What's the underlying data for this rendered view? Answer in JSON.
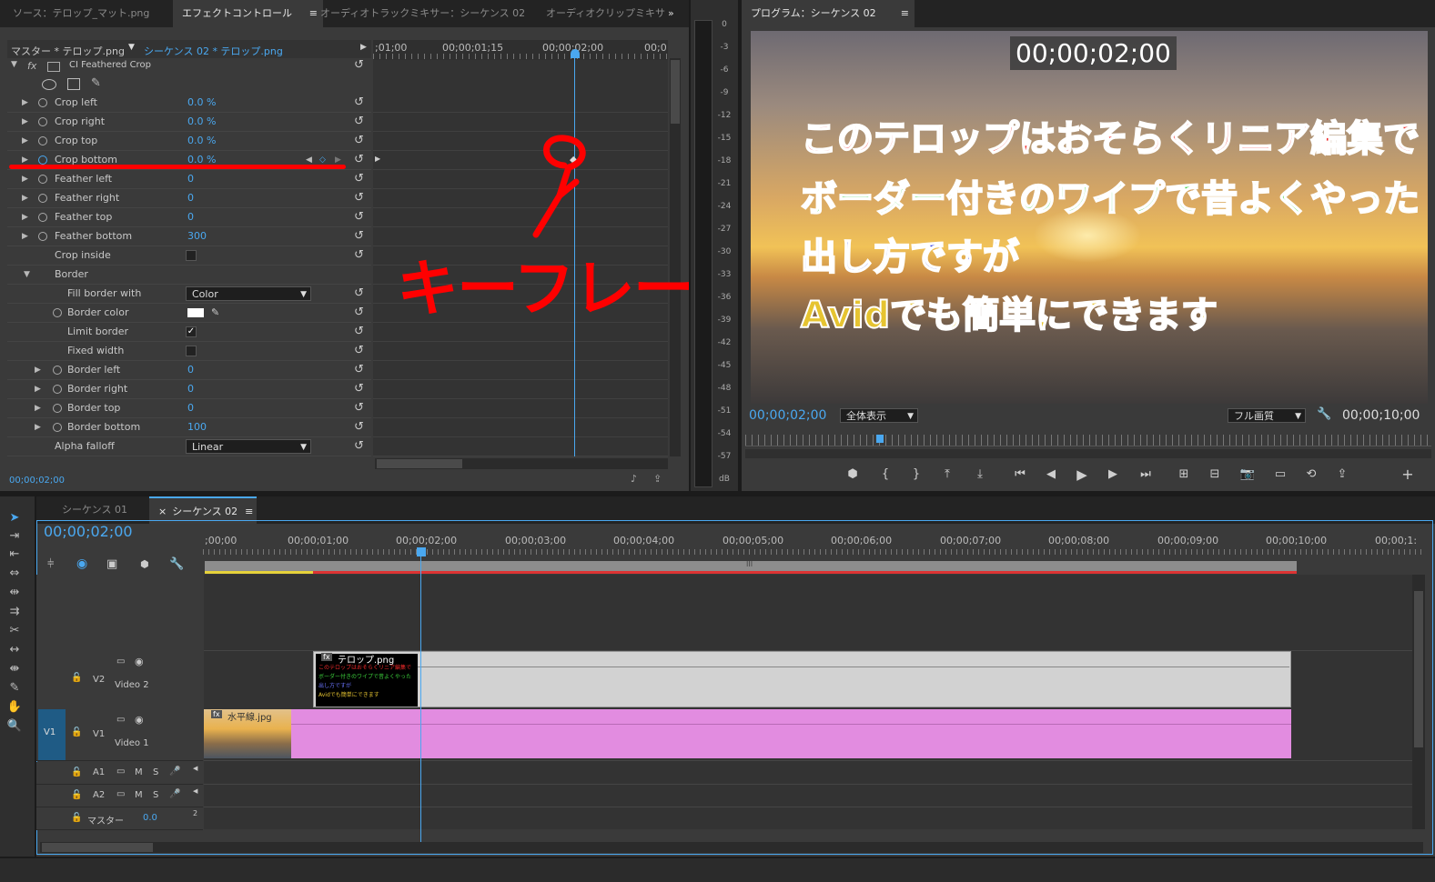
{
  "tabs_left": [
    "ソース：テロップ_マット.png",
    "エフェクトコントロール",
    "オーディオトラックミキサー：シーケンス 02",
    "オーディオクリップミキサ"
  ],
  "tabs_left_more": "»",
  "program_title": "プログラム：シーケンス 02",
  "panel_menu_icon": "≡",
  "effect_controls": {
    "master_label": "マスター * テロップ.png",
    "sequence_label": "シーケンス 02 * テロップ.png",
    "effect_name": "CI Feathered Crop",
    "fx_label": "fx",
    "ruler_times": [
      ";01;00",
      "00;00;01;15",
      "00;00;02;00",
      "00;0"
    ],
    "params": [
      {
        "label": "Crop left",
        "value": "0.0 %"
      },
      {
        "label": "Crop right",
        "value": "0.0 %"
      },
      {
        "label": "Crop top",
        "value": "0.0 %"
      },
      {
        "label": "Crop bottom",
        "value": "0.0 %"
      },
      {
        "label": "Feather left",
        "value": "0"
      },
      {
        "label": "Feather right",
        "value": "0"
      },
      {
        "label": "Feather top",
        "value": "0"
      },
      {
        "label": "Feather bottom",
        "value": "300"
      }
    ],
    "crop_inside_label": "Crop inside",
    "border_group_label": "Border",
    "fill_border_label": "Fill border with",
    "fill_border_value": "Color",
    "border_color_label": "Border color",
    "limit_border_label": "Limit border",
    "fixed_width_label": "Fixed width",
    "border_params": [
      {
        "label": "Border left",
        "value": "0"
      },
      {
        "label": "Border right",
        "value": "0"
      },
      {
        "label": "Border top",
        "value": "0"
      },
      {
        "label": "Border bottom",
        "value": "100"
      }
    ],
    "alpha_falloff_label": "Alpha falloff",
    "alpha_falloff_value": "Linear",
    "timecode": "00;00;02;00",
    "annotation_text": "キーフレーム"
  },
  "audio_meter": {
    "labels": [
      "0",
      "-3",
      "-6",
      "-9",
      "-12",
      "-15",
      "-18",
      "-21",
      "-24",
      "-27",
      "-30",
      "-33",
      "-36",
      "-39",
      "-42",
      "-45",
      "-48",
      "-51",
      "-54",
      "-57",
      "dB"
    ]
  },
  "program": {
    "overlay_timecode": "00;00;02;00",
    "captions": [
      {
        "text": "このテロップはおそらくリニア編集で",
        "color": "#ee2a2a"
      },
      {
        "text": "ボーダー付きのワイプで昔よくやった",
        "color": "#3ccf3c"
      },
      {
        "text": "出し方ですが",
        "color": "#2a37e0"
      },
      {
        "text": "Avidでも簡単にできます",
        "color": "#e6c431"
      }
    ],
    "current_time": "00;00;02;00",
    "zoom_select": "全体表示",
    "quality_select": "フル画質",
    "duration": "00;00;10;00"
  },
  "timeline": {
    "tabs": [
      "シーケンス 01",
      "シーケンス 02"
    ],
    "tab_close": "×",
    "timecode": "00;00;02;00",
    "ruler_labels": [
      ";00;00",
      "00;00;01;00",
      "00;00;02;00",
      "00;00;03;00",
      "00;00;04;00",
      "00;00;05;00",
      "00;00;06;00",
      "00;00;07;00",
      "00;00;08;00",
      "00;00;09;00",
      "00;00;10;00",
      "00;00;1:"
    ],
    "tracks": {
      "v2_label": "V2",
      "v2_name": "Video 2",
      "v1_src": "V1",
      "v1_label": "V1",
      "v1_name": "Video 1",
      "a1_label": "A1",
      "a2_label": "A2",
      "master_label": "マスター",
      "master_value": "0.0",
      "mute": "M",
      "solo": "S"
    },
    "clips": {
      "v2_clip": "テロップ.png",
      "v1_clip": "水平線.jpg",
      "fx_badge": "fx",
      "mini_caption_lines": [
        {
          "text": "このテロップはおそらくリニア編集で",
          "color": "#ee2a2a"
        },
        {
          "text": "ボーダー付きのワイプで昔よくやった",
          "color": "#3ccf3c"
        },
        {
          "text": "出し方ですが",
          "color": "#6b75ff"
        },
        {
          "text": "Avidでも簡単にできます",
          "color": "#e6c431"
        }
      ]
    },
    "work_area_mark": "III"
  },
  "colors": {
    "accent_blue": "#4aa8f0",
    "clip_gray": "#d2d2d2",
    "clip_pink": "#e28ce0",
    "annotation_red": "#ff0000",
    "panel_bg": "#3a3a3a"
  }
}
